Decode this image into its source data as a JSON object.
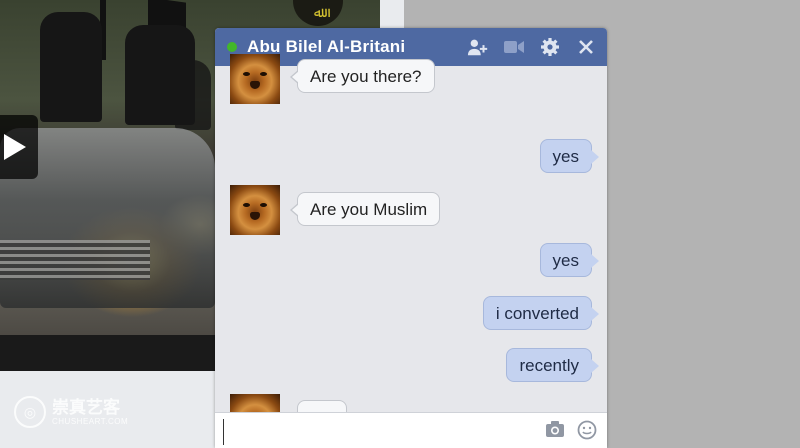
{
  "chat": {
    "contact_name": "Abu Bilel Al-Britani",
    "status_color": "#42b72a",
    "header_color": "#4e69a2",
    "header_icons": [
      "add-friend-icon",
      "video-call-icon",
      "gear-icon",
      "close-icon"
    ],
    "messages": [
      {
        "from": "contact",
        "text": "Are you there?"
      },
      {
        "from": "me",
        "text": "yes"
      },
      {
        "from": "contact",
        "text": "Are you Muslim"
      },
      {
        "from": "me",
        "text": "yes"
      },
      {
        "from": "me",
        "text": "i converted"
      },
      {
        "from": "me",
        "text": "recently"
      },
      {
        "from": "contact",
        "text": "•••"
      }
    ],
    "composer": {
      "value": "",
      "icons": [
        "camera-icon",
        "emoji-icon"
      ]
    }
  },
  "background": {
    "video_emblem": "ﷲ",
    "watermark_title": "崇真艺客",
    "watermark_sub": "CHUSHEART.COM"
  }
}
